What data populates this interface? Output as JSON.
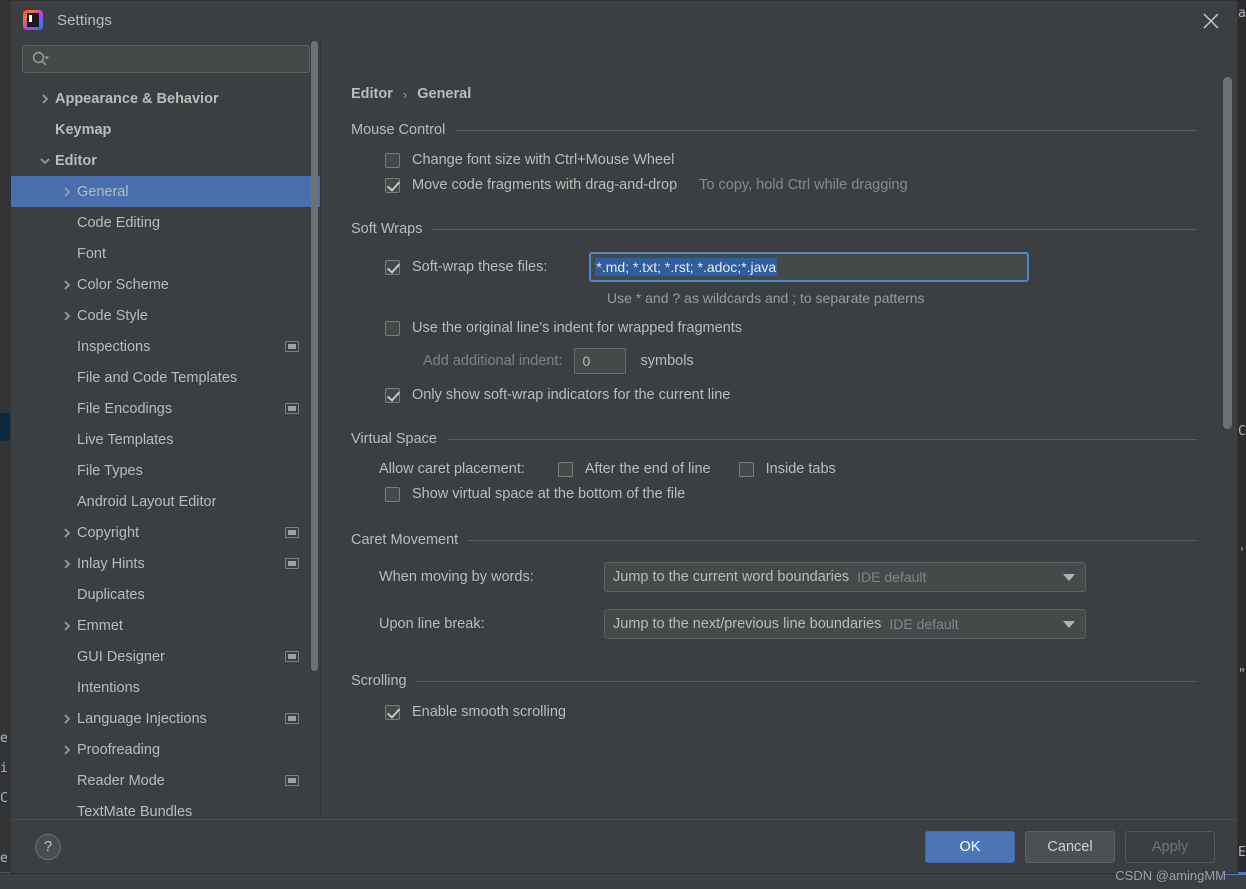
{
  "window": {
    "title": "Settings",
    "app_icon": "intellij-idea-icon",
    "close_icon": "close-icon"
  },
  "sidebar": {
    "search": {
      "placeholder": "",
      "value": "",
      "icon": "search-icon"
    },
    "items": [
      {
        "label": "Appearance & Behavior",
        "level": 0,
        "arrow": "chevron-right",
        "bold": true,
        "badge": false
      },
      {
        "label": "Keymap",
        "level": 0,
        "arrow": "",
        "bold": true,
        "badge": false
      },
      {
        "label": "Editor",
        "level": 0,
        "arrow": "chevron-down",
        "bold": true,
        "badge": false
      },
      {
        "label": "General",
        "level": 1,
        "arrow": "chevron-right",
        "bold": false,
        "badge": false,
        "selected": true
      },
      {
        "label": "Code Editing",
        "level": 1,
        "arrow": "",
        "bold": false,
        "badge": false
      },
      {
        "label": "Font",
        "level": 1,
        "arrow": "",
        "bold": false,
        "badge": false
      },
      {
        "label": "Color Scheme",
        "level": 1,
        "arrow": "chevron-right",
        "bold": false,
        "badge": false
      },
      {
        "label": "Code Style",
        "level": 1,
        "arrow": "chevron-right",
        "bold": false,
        "badge": false
      },
      {
        "label": "Inspections",
        "level": 1,
        "arrow": "",
        "bold": false,
        "badge": true
      },
      {
        "label": "File and Code Templates",
        "level": 1,
        "arrow": "",
        "bold": false,
        "badge": false
      },
      {
        "label": "File Encodings",
        "level": 1,
        "arrow": "",
        "bold": false,
        "badge": true
      },
      {
        "label": "Live Templates",
        "level": 1,
        "arrow": "",
        "bold": false,
        "badge": false
      },
      {
        "label": "File Types",
        "level": 1,
        "arrow": "",
        "bold": false,
        "badge": false
      },
      {
        "label": "Android Layout Editor",
        "level": 1,
        "arrow": "",
        "bold": false,
        "badge": false
      },
      {
        "label": "Copyright",
        "level": 1,
        "arrow": "chevron-right",
        "bold": false,
        "badge": true
      },
      {
        "label": "Inlay Hints",
        "level": 1,
        "arrow": "chevron-right",
        "bold": false,
        "badge": true
      },
      {
        "label": "Duplicates",
        "level": 1,
        "arrow": "",
        "bold": false,
        "badge": false
      },
      {
        "label": "Emmet",
        "level": 1,
        "arrow": "chevron-right",
        "bold": false,
        "badge": false
      },
      {
        "label": "GUI Designer",
        "level": 1,
        "arrow": "",
        "bold": false,
        "badge": true
      },
      {
        "label": "Intentions",
        "level": 1,
        "arrow": "",
        "bold": false,
        "badge": false
      },
      {
        "label": "Language Injections",
        "level": 1,
        "arrow": "chevron-right",
        "bold": false,
        "badge": true
      },
      {
        "label": "Proofreading",
        "level": 1,
        "arrow": "chevron-right",
        "bold": false,
        "badge": false
      },
      {
        "label": "Reader Mode",
        "level": 1,
        "arrow": "",
        "bold": false,
        "badge": true
      },
      {
        "label": "TextMate Bundles",
        "level": 1,
        "arrow": "",
        "bold": false,
        "badge": false
      }
    ]
  },
  "main": {
    "breadcrumb": {
      "parent": "Editor",
      "separator": "›",
      "current": "General"
    },
    "sections": {
      "mouse_control": {
        "title": "Mouse Control",
        "change_font_size": {
          "label": "Change font size with Ctrl+Mouse Wheel",
          "checked": false
        },
        "move_code": {
          "label": "Move code fragments with drag-and-drop",
          "checked": true,
          "hint": "To copy, hold Ctrl while dragging"
        }
      },
      "soft_wraps": {
        "title": "Soft Wraps",
        "soft_wrap_files": {
          "label": "Soft-wrap these files:",
          "checked": true,
          "value": "*.md; *.txt; *.rst; *.adoc;*.java",
          "selected": true
        },
        "wildcard_hint": "Use * and ? as wildcards and ; to separate patterns",
        "original_indent": {
          "label": "Use the original line's indent for wrapped fragments",
          "checked": false
        },
        "additional_indent": {
          "label": "Add additional indent:",
          "value": "0",
          "unit": "symbols",
          "disabled": true
        },
        "only_show_indicators": {
          "label": "Only show soft-wrap indicators for the current line",
          "checked": true
        }
      },
      "virtual_space": {
        "title": "Virtual Space",
        "allow_caret_label": "Allow caret placement:",
        "after_end_of_line": {
          "label": "After the end of line",
          "checked": false
        },
        "inside_tabs": {
          "label": "Inside tabs",
          "checked": false
        },
        "show_virtual_space": {
          "label": "Show virtual space at the bottom of the file",
          "checked": false
        }
      },
      "caret_movement": {
        "title": "Caret Movement",
        "when_moving_by_words": {
          "label": "When moving by words:",
          "value": "Jump to the current word boundaries",
          "sub": "IDE default"
        },
        "upon_line_break": {
          "label": "Upon line break:",
          "value": "Jump to the next/previous line boundaries",
          "sub": "IDE default"
        }
      },
      "scrolling": {
        "title": "Scrolling",
        "smooth_scrolling": {
          "label": "Enable smooth scrolling",
          "checked": true
        }
      }
    }
  },
  "footer": {
    "help_label": "?",
    "ok_label": "OK",
    "cancel_label": "Cancel",
    "apply_label": "Apply"
  },
  "watermark": "CSDN @amingMM",
  "backdrop": {
    "left_lines": [
      "e",
      "i",
      "C",
      "e"
    ],
    "right_lines": [
      "a",
      "C",
      "'",
      "\"",
      "E"
    ]
  },
  "colors": {
    "accent": "#4a76b8",
    "selection": "#4b6eaf",
    "text_selection": "#2f5d9e",
    "panel_bg": "#3c3f41",
    "field_bg": "#45494a",
    "focus_border": "#4a88c7"
  }
}
